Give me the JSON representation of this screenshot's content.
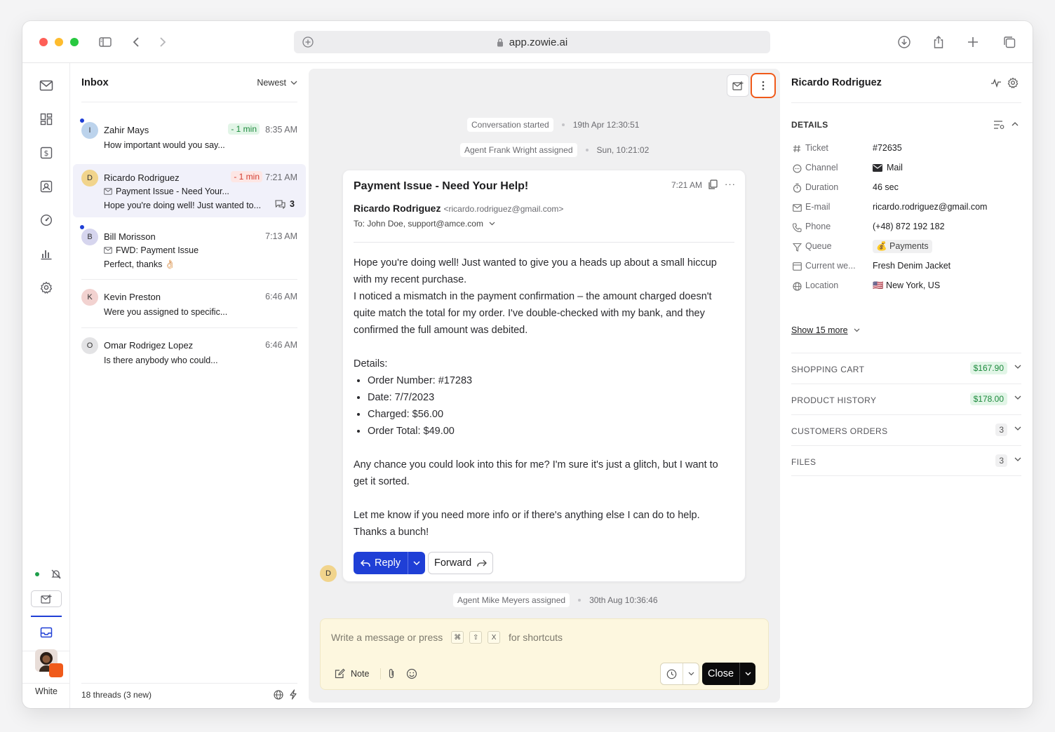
{
  "browser": {
    "url": "app.zowie.ai"
  },
  "rail": {
    "user_label": "White"
  },
  "inbox": {
    "title": "Inbox",
    "sort": "Newest",
    "footer": "18 threads (3 new)",
    "threads": [
      {
        "initial": "I",
        "name": "Zahir Mays",
        "sla": "- 1 min",
        "time": "8:35 AM",
        "preview": "How important would you say..."
      },
      {
        "initial": "D",
        "name": "Ricardo Rodriguez",
        "sla": "- 1 min",
        "time": "7:21 AM",
        "subject": "Payment Issue - Need Your...",
        "preview": "Hope you're doing well! Just wanted to...",
        "count": "3"
      },
      {
        "initial": "B",
        "name": "Bill Morisson",
        "time": "7:13 AM",
        "subject": "FWD: Payment Issue",
        "preview": "Perfect, thanks 👌🏻"
      },
      {
        "initial": "K",
        "name": "Kevin Preston",
        "time": "6:46 AM",
        "preview": "Were you assigned to specific..."
      },
      {
        "initial": "O",
        "name": "Omar Rodrigez Lopez",
        "time": "6:46 AM",
        "preview": "Is there anybody who could..."
      }
    ]
  },
  "conversation": {
    "events": [
      {
        "label": "Conversation started",
        "time": "19th Apr 12:30:51"
      },
      {
        "label": "Agent Frank Wright assigned",
        "time": "Sun, 10:21:02"
      },
      {
        "label": "Agent Mike Meyers assigned",
        "time": "30th Aug 10:36:46"
      }
    ],
    "mail": {
      "subject": "Payment Issue - Need Your Help!",
      "time": "7:21 AM",
      "from_name": "Ricardo Rodriguez",
      "from_email": "<ricardo.rodriguez@gmail.com>",
      "to": "To: John Doe, support@amce.com",
      "p1": "Hope you're doing well! Just wanted to give you a heads up about a small hiccup with my recent purchase.",
      "p2": "I noticed a mismatch in the payment confirmation – the amount charged doesn't quite match the total for my order. I've double-checked with my bank, and they confirmed the full amount was debited.",
      "details_label": "Details:",
      "items": [
        "Order Number: #17283",
        "Date: 7/7/2023",
        "Charged: $56.00",
        "Order Total: $49.00"
      ],
      "p3": "Any chance you could look into this for me? I'm sure it's just a glitch, but I want to get it sorted.",
      "p4": "Let me know if you need more info or if there's anything else I can do to help.",
      "p5": "Thanks a bunch!",
      "reply_label": "Reply",
      "forward_label": "Forward",
      "sender_initial": "D"
    },
    "composer": {
      "placeholder_start": "Write a message or press",
      "placeholder_end": "for shortcuts",
      "keys": [
        "⌘",
        "⇧",
        "X"
      ],
      "note_label": "Note",
      "close_label": "Close"
    }
  },
  "details": {
    "customer_name": "Ricardo Rodriguez",
    "section_title": "DETAILS",
    "rows": [
      {
        "label": "Ticket",
        "value": "#72635"
      },
      {
        "label": "Channel",
        "value": "Mail"
      },
      {
        "label": "Duration",
        "value": "46 sec"
      },
      {
        "label": "E-mail",
        "value": "ricardo.rodriguez@gmail.com"
      },
      {
        "label": "Phone",
        "value": "(+48) 872 192 182"
      },
      {
        "label": "Queue",
        "value": "💰 Payments"
      },
      {
        "label": "Current we...",
        "value": "Fresh Denim Jacket"
      },
      {
        "label": "Location",
        "value": "🇺🇸 New York, US"
      }
    ],
    "show_more": "Show 15 more",
    "sections": [
      {
        "title": "SHOPPING CART",
        "badge": "$167.90"
      },
      {
        "title": "PRODUCT HISTORY",
        "badge": "$178.00"
      },
      {
        "title": "CUSTOMERS ORDERS",
        "badge": "3"
      },
      {
        "title": "FILES",
        "badge": "3"
      }
    ]
  },
  "colors": {
    "accent": "#1f3fd6",
    "highlight_border": "#f05a1a",
    "sla_green": "#e2f5e7",
    "sla_red": "#fde6e4",
    "composer_bg": "#fdf7df"
  }
}
